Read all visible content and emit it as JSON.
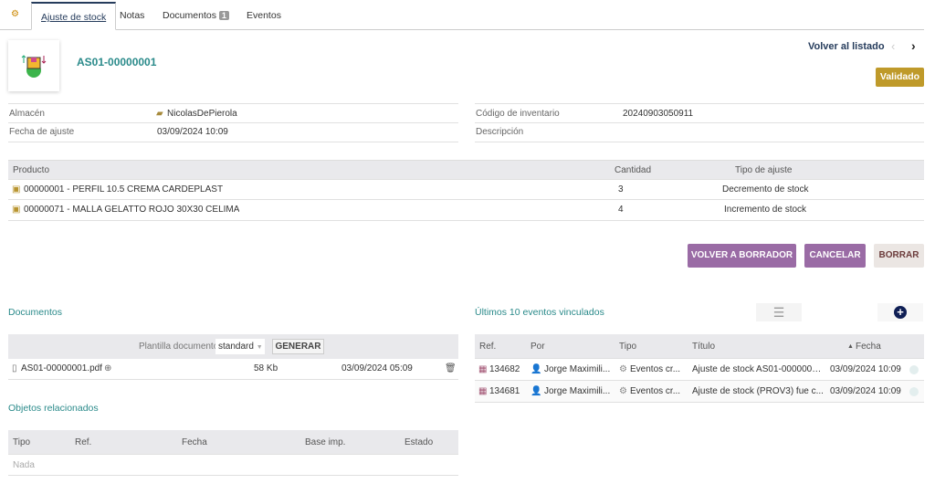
{
  "tabs": {
    "ajuste": "Ajuste de stock",
    "notas": "Notas",
    "documentos": "Documentos",
    "documentos_count": "1",
    "eventos": "Eventos"
  },
  "header": {
    "ref": "AS01-00000001",
    "back": "Volver al listado",
    "status": "Validado",
    "colors": {
      "status": "#bf9a2a",
      "ref": "#2a8a8a",
      "action": "#9a6ba5"
    }
  },
  "fields": {
    "almacen_label": "Almacén",
    "almacen": "NicolasDePierola",
    "fecha_label": "Fecha de ajuste",
    "fecha": "03/09/2024 10:09",
    "codigo_label": "Código de inventario",
    "codigo": "20240903050911",
    "desc_label": "Descripción"
  },
  "products": {
    "headers": [
      "Producto",
      "Cantidad",
      "Tipo de ajuste"
    ],
    "rows": [
      {
        "producto": "00000001 - PERFIL 10.5 CREMA CARDEPLAST",
        "cantidad": "3",
        "tipo": "Decremento de stock"
      },
      {
        "producto": "00000071 - MALLA GELATTO ROJO 30X30 CELIMA",
        "cantidad": "4",
        "tipo": "Incremento de stock"
      }
    ]
  },
  "actions": {
    "borrador": "VOLVER A BORRADOR",
    "cancelar": "CANCELAR",
    "borrar": "BORRAR"
  },
  "documents": {
    "title": "Documentos",
    "template_label": "Plantilla documento",
    "template_value": "standard",
    "generate": "GENERAR",
    "file": {
      "name": "AS01-00000001.pdf",
      "size": "58 Kb",
      "date": "03/09/2024 05:09"
    }
  },
  "related": {
    "title": "Objetos relacionados",
    "headers": [
      "Tipo",
      "Ref.",
      "Fecha",
      "Base imp.",
      "Estado"
    ],
    "empty": "Nada"
  },
  "events": {
    "title": "Últimos 10 eventos vinculados",
    "headers": [
      "Ref.",
      "Por",
      "Tipo",
      "Título",
      "Fecha"
    ],
    "rows": [
      {
        "ref": "134682",
        "por": "Jorge Maximili...",
        "tipo": "Eventos cr...",
        "titulo": "Ajuste de stock AS01-0000000...",
        "fecha": "03/09/2024 10:09"
      },
      {
        "ref": "134681",
        "por": "Jorge Maximili...",
        "tipo": "Eventos cr...",
        "titulo": "Ajuste de stock (PROV3) fue c...",
        "fecha": "03/09/2024 10:09"
      }
    ]
  }
}
